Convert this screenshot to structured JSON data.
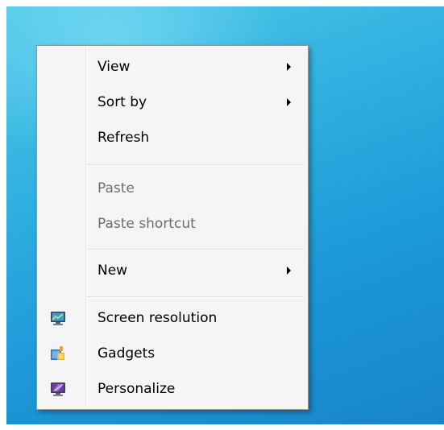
{
  "menu": {
    "items": [
      {
        "label": "View",
        "submenu": true,
        "enabled": true
      },
      {
        "label": "Sort by",
        "submenu": true,
        "enabled": true
      },
      {
        "label": "Refresh",
        "enabled": true
      },
      {
        "label": "Paste",
        "enabled": false
      },
      {
        "label": "Paste shortcut",
        "enabled": false
      },
      {
        "label": "New",
        "submenu": true,
        "enabled": true
      },
      {
        "label": "Screen resolution",
        "icon": "monitor-icon",
        "enabled": true
      },
      {
        "label": "Gadgets",
        "icon": "gadgets-icon",
        "enabled": true
      },
      {
        "label": "Personalize",
        "icon": "personalize-icon",
        "enabled": true
      }
    ]
  },
  "colors": {
    "desktop": "#2fb0e0",
    "menu_background": "#f5f5f5",
    "disabled_text": "#6d6d6d"
  }
}
